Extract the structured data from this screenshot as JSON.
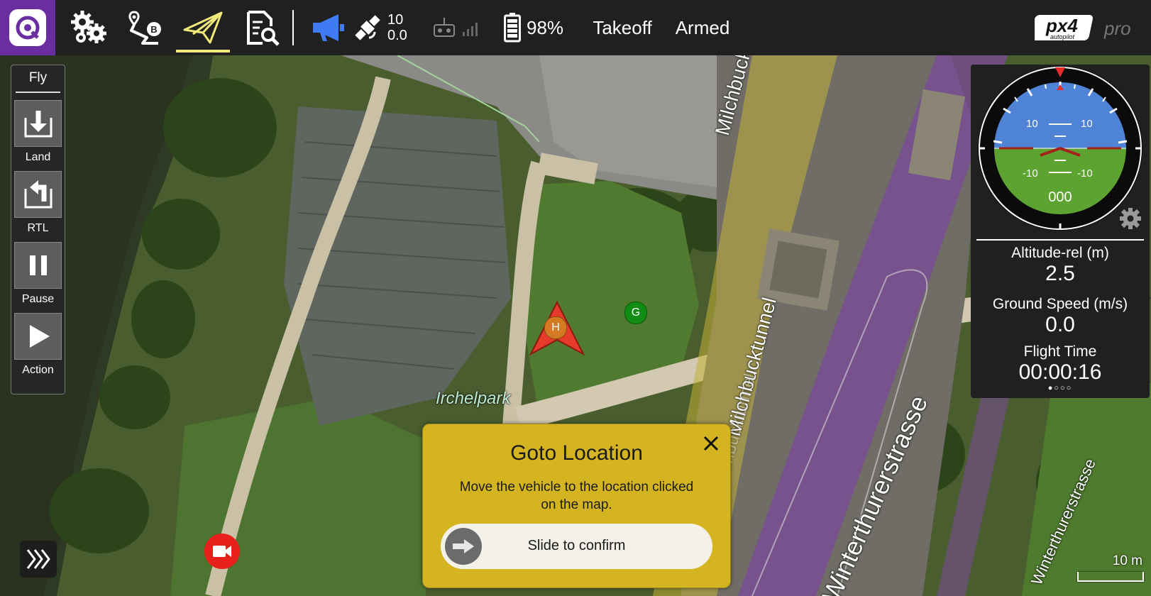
{
  "toolbar": {
    "app_logo_icon": "qgc-logo-icon",
    "settings_icon": "gears-icon",
    "plan_icon": "plan-path-icon",
    "fly_icon": "paper-plane-icon",
    "analyze_icon": "document-search-icon",
    "messages_icon": "megaphone-icon",
    "gps_satellite_count": "10",
    "gps_hdop": "0.0",
    "rc_icon": "rc-transmitter-icon",
    "battery_percent": "98%",
    "flight_mode": "Takeoff",
    "arm_state": "Armed",
    "brand_logo": "px4 autopilot pro",
    "accent_color": "#f1e87a",
    "messages_color": "#3f7bf5"
  },
  "fly_panel": {
    "title": "Fly",
    "buttons": [
      {
        "label": "Land",
        "icon": "land-arrow-icon"
      },
      {
        "label": "RTL",
        "icon": "return-arrow-icon"
      },
      {
        "label": "Pause",
        "icon": "pause-icon"
      },
      {
        "label": "Action",
        "icon": "play-icon"
      }
    ]
  },
  "map": {
    "labels": {
      "park": "Irchelpark",
      "tunnel_top": "Milchbucktunnel",
      "tunnel_mid": "Milchbucktunnel",
      "street_main": "Winterthurerstrasse",
      "street_right": "Winterthurerstrasse",
      "street_right2": "Milchbucktunnel"
    },
    "home_marker": "H",
    "goal_marker": "G",
    "scale_label": "10 m",
    "vehicle_color": "#e63a2b"
  },
  "instrument": {
    "compass_icon": "attitude-indicator-icon",
    "pitch_ticks": [
      "10",
      "10",
      "-10",
      "-10"
    ],
    "heading": "000",
    "settings_icon": "gear-icon",
    "values": [
      {
        "label": "Altitude-rel (m)",
        "value": "2.5"
      },
      {
        "label": "Ground Speed (m/s)",
        "value": "0.0"
      },
      {
        "label": "Flight Time",
        "value": "00:00:16"
      }
    ],
    "page_indicator": "●○○○"
  },
  "goto_dialog": {
    "title": "Goto Location",
    "description": "Move the vehicle to the location clicked on the map.",
    "slider_label": "Slide to confirm",
    "close_icon": "close-icon",
    "knob_icon": "arrow-right-icon"
  },
  "bottom": {
    "expand_icon": "chevron-triple-right-icon",
    "video_icon": "video-camera-icon"
  }
}
